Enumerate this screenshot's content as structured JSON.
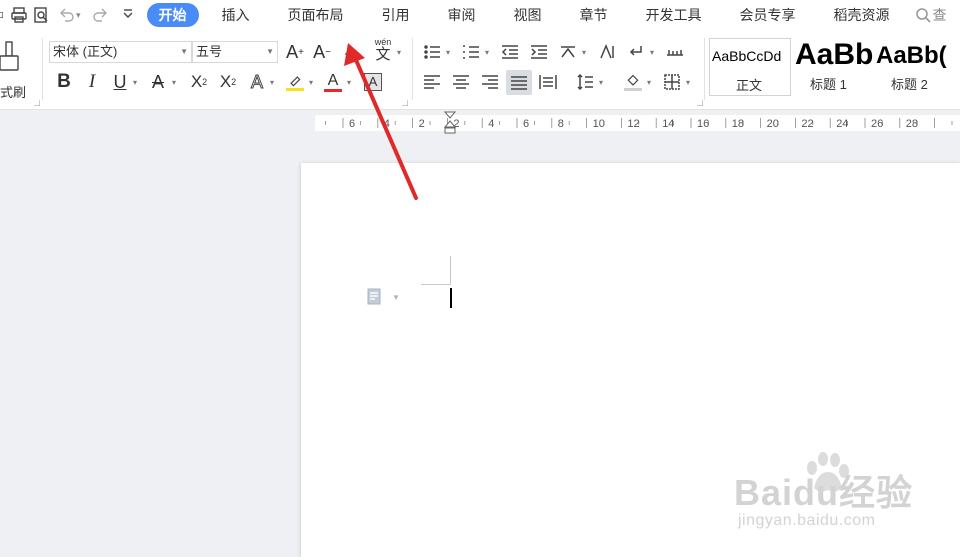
{
  "tabbar": {
    "tabs": [
      {
        "label": "开始",
        "active": true
      },
      {
        "label": "插入"
      },
      {
        "label": "页面布局"
      },
      {
        "label": "引用"
      },
      {
        "label": "审阅"
      },
      {
        "label": "视图"
      },
      {
        "label": "章节"
      },
      {
        "label": "开发工具"
      },
      {
        "label": "会员专享"
      },
      {
        "label": "稻壳资源"
      }
    ],
    "search_label": "查",
    "accent": "#4a8cf7"
  },
  "ribbon": {
    "format_painter_label": "式刷",
    "font_name": "宋体 (正文)",
    "font_size": "五号",
    "pinyin_label": "wén",
    "superscript": "2",
    "subscript": "2",
    "styles": [
      {
        "preview": "AaBbCcDd",
        "name": "正文"
      },
      {
        "preview": "AaBb",
        "name": "标题 1"
      },
      {
        "preview": "AaBb(",
        "name": "标题 2"
      }
    ]
  },
  "ruler": {
    "labels": [
      "6",
      "4",
      "2",
      "2",
      "4",
      "6",
      "8",
      "10",
      "12",
      "14",
      "16",
      "18",
      "20",
      "22",
      "24",
      "26",
      "28"
    ]
  },
  "annotation": {
    "arrow_color": "#e02a2a"
  },
  "watermark": {
    "brand": "Baidu经验",
    "url": "jingyan.baidu.com"
  }
}
